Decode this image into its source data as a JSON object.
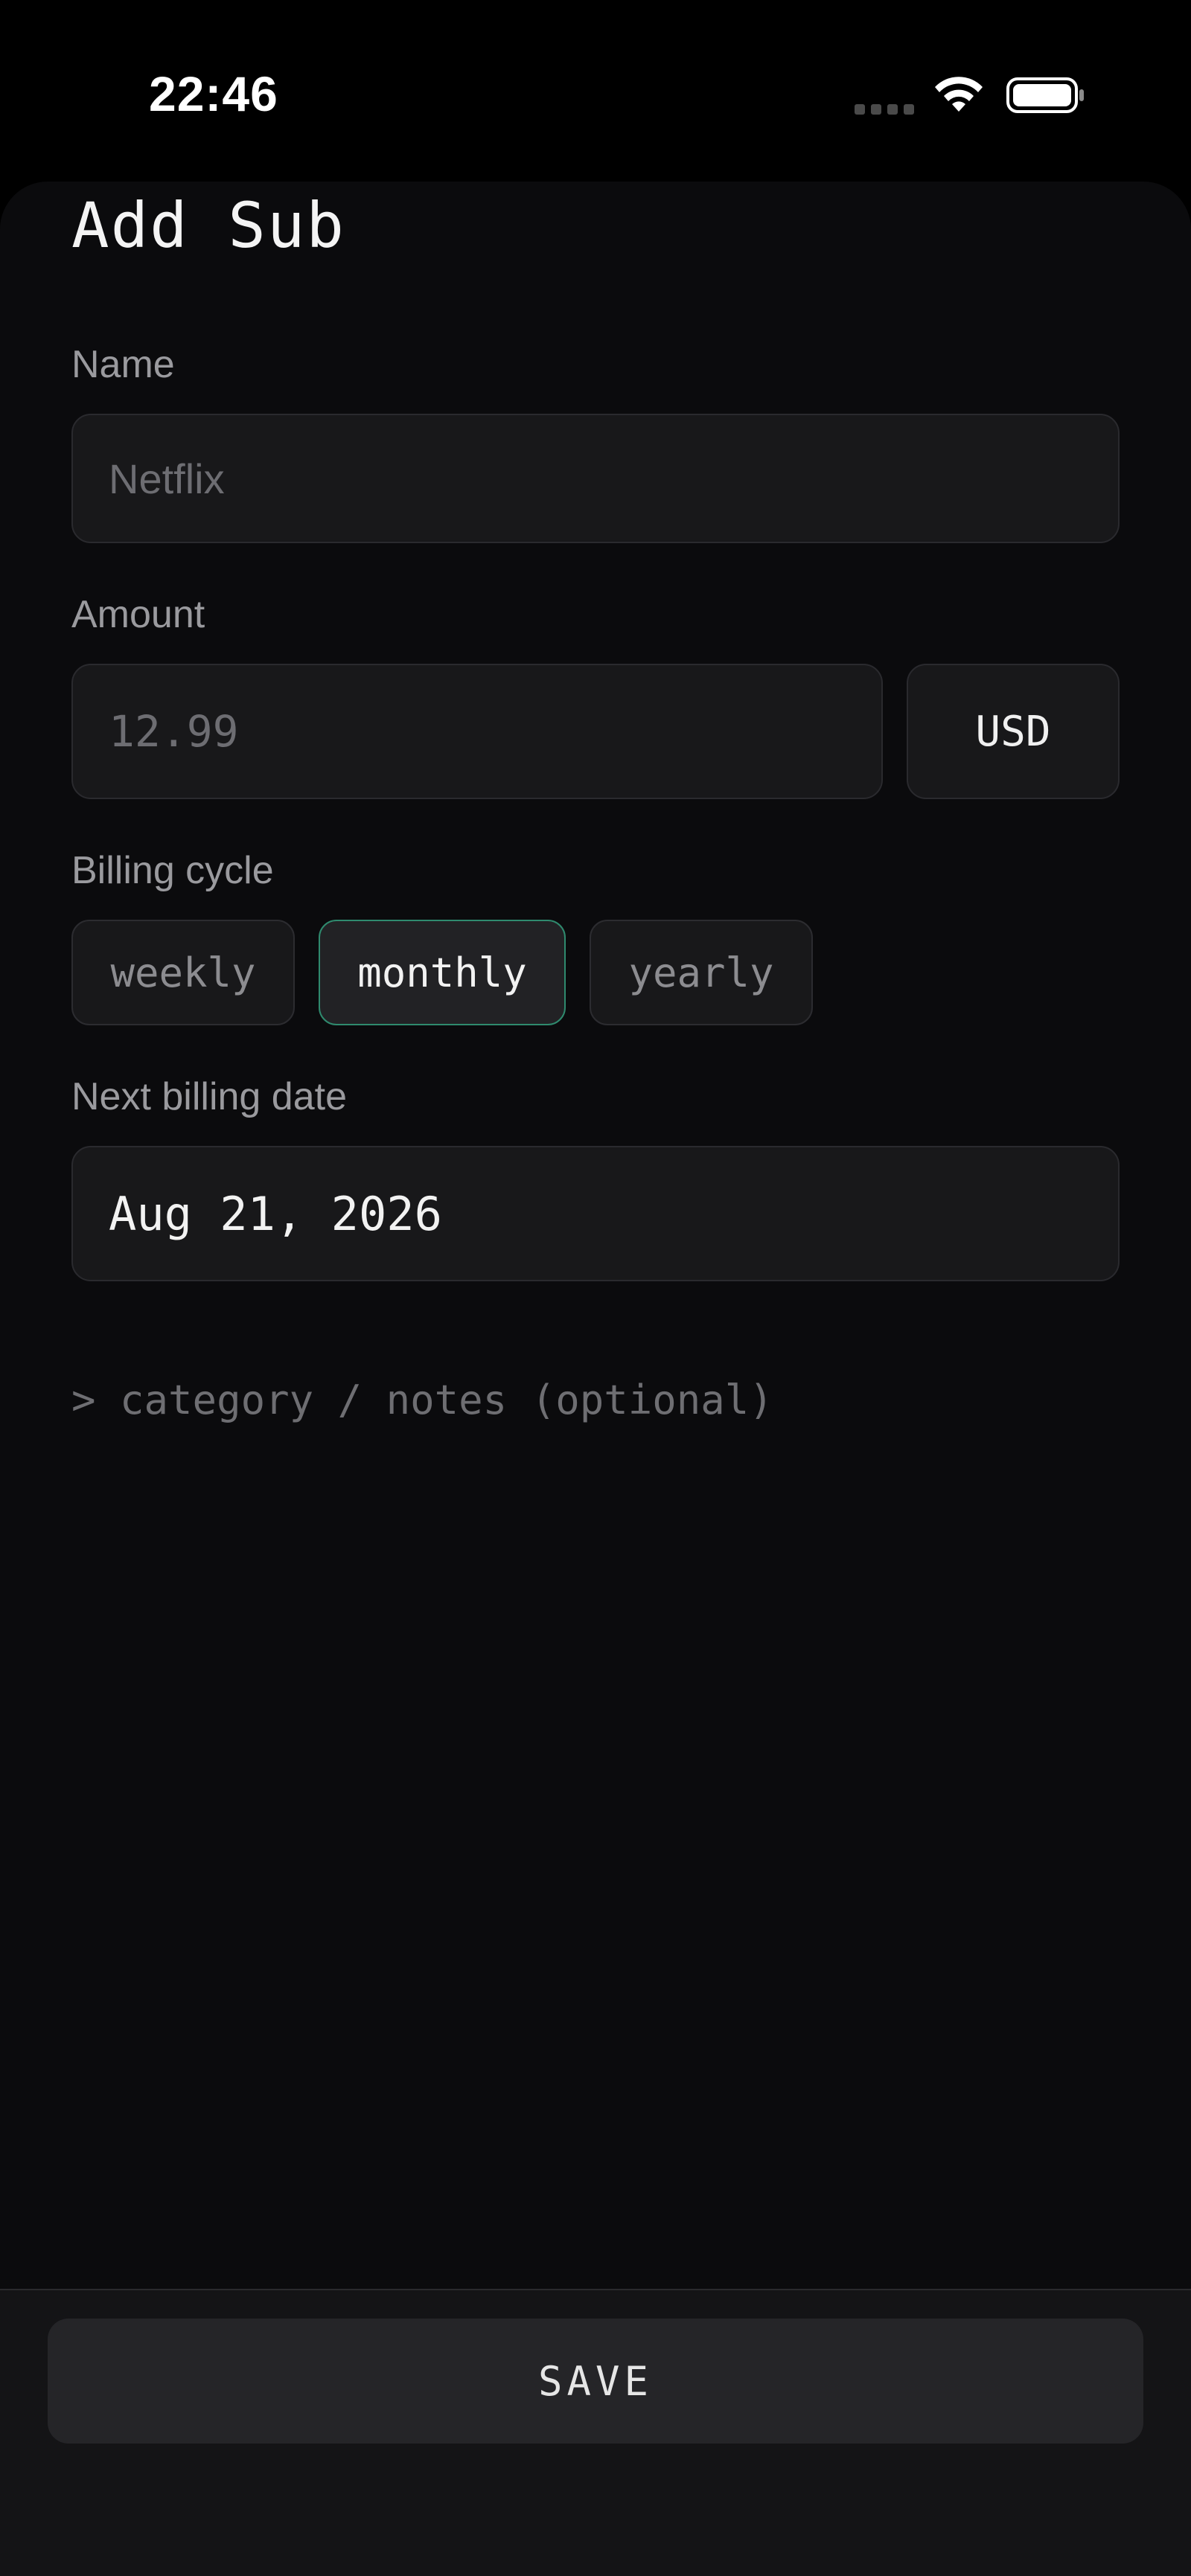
{
  "status_bar": {
    "time": "22:46"
  },
  "sheet": {
    "title": "Add Sub"
  },
  "form": {
    "name": {
      "label": "Name",
      "placeholder": "Netflix"
    },
    "amount": {
      "label": "Amount",
      "placeholder": "12.99",
      "currency": "USD"
    },
    "billing_cycle": {
      "label": "Billing cycle",
      "options": [
        "weekly",
        "monthly",
        "yearly"
      ],
      "selected": "monthly"
    },
    "next_billing_date": {
      "label": "Next billing date",
      "value": "Aug 21, 2026"
    },
    "optional_toggle": "> category / notes (optional)"
  },
  "footer": {
    "save_label": "SAVE"
  },
  "colors": {
    "background": "#0b0b0d",
    "field": "#18181a",
    "accent_selected_border": "#2f8a6e",
    "muted_text": "#9a9a9e"
  },
  "icons": [
    "wifi-icon",
    "battery-icon",
    "signal-icon"
  ]
}
